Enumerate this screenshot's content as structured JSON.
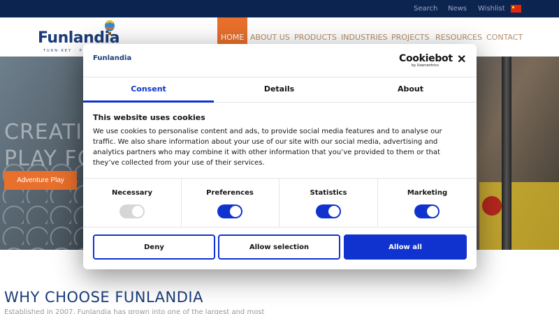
{
  "topbar": {
    "links": [
      {
        "label": "Search"
      },
      {
        "label": "News"
      },
      {
        "label": "Wishlist"
      }
    ]
  },
  "header": {
    "logo_text": "Funlandia",
    "logo_tagline": "TURN·KEY · PLAY",
    "nav": [
      {
        "label": "HOME",
        "active": true
      },
      {
        "label": "ABOUT US"
      },
      {
        "label": "PRODUCTS"
      },
      {
        "label": "INDUSTRIES"
      },
      {
        "label": "PROJECTS"
      },
      {
        "label": "RESOURCES"
      },
      {
        "label": "CONTACT"
      }
    ]
  },
  "hero": {
    "title_line1": "CREATI",
    "title_line2": "PLAY FO",
    "button_label": "Adventure Play"
  },
  "why": {
    "title": "WHY CHOOSE FUNLANDIA",
    "text": "Established in 2007, Funlandia has grown into one of the largest and most"
  },
  "dialog": {
    "brand_logo": "Funlandia",
    "cookiebot_logo": "Cookiebot",
    "cookiebot_sub": "by Usercentrics",
    "close_label": "✕",
    "tabs": [
      {
        "label": "Consent",
        "active": true
      },
      {
        "label": "Details"
      },
      {
        "label": "About"
      }
    ],
    "heading": "This website uses cookies",
    "body": "We use cookies to personalise content and ads, to provide social media features and to analyse our traffic. We also share information about your use of our site with our social media, advertising and analytics partners who may combine it with other information that you’ve provided to them or that they’ve collected from your use of their services.",
    "categories": [
      {
        "label": "Necessary",
        "checked": true,
        "disabled": true
      },
      {
        "label": "Preferences",
        "checked": true
      },
      {
        "label": "Statistics",
        "checked": true
      },
      {
        "label": "Marketing",
        "checked": true
      }
    ],
    "buttons": {
      "deny": "Deny",
      "allow_selection": "Allow selection",
      "allow_all": "Allow all"
    }
  },
  "colors": {
    "topbar": "#0c2450",
    "accent_orange": "#e86f2c",
    "cookiebot_blue": "#1032cf",
    "brand_navy": "#1b3c78"
  }
}
